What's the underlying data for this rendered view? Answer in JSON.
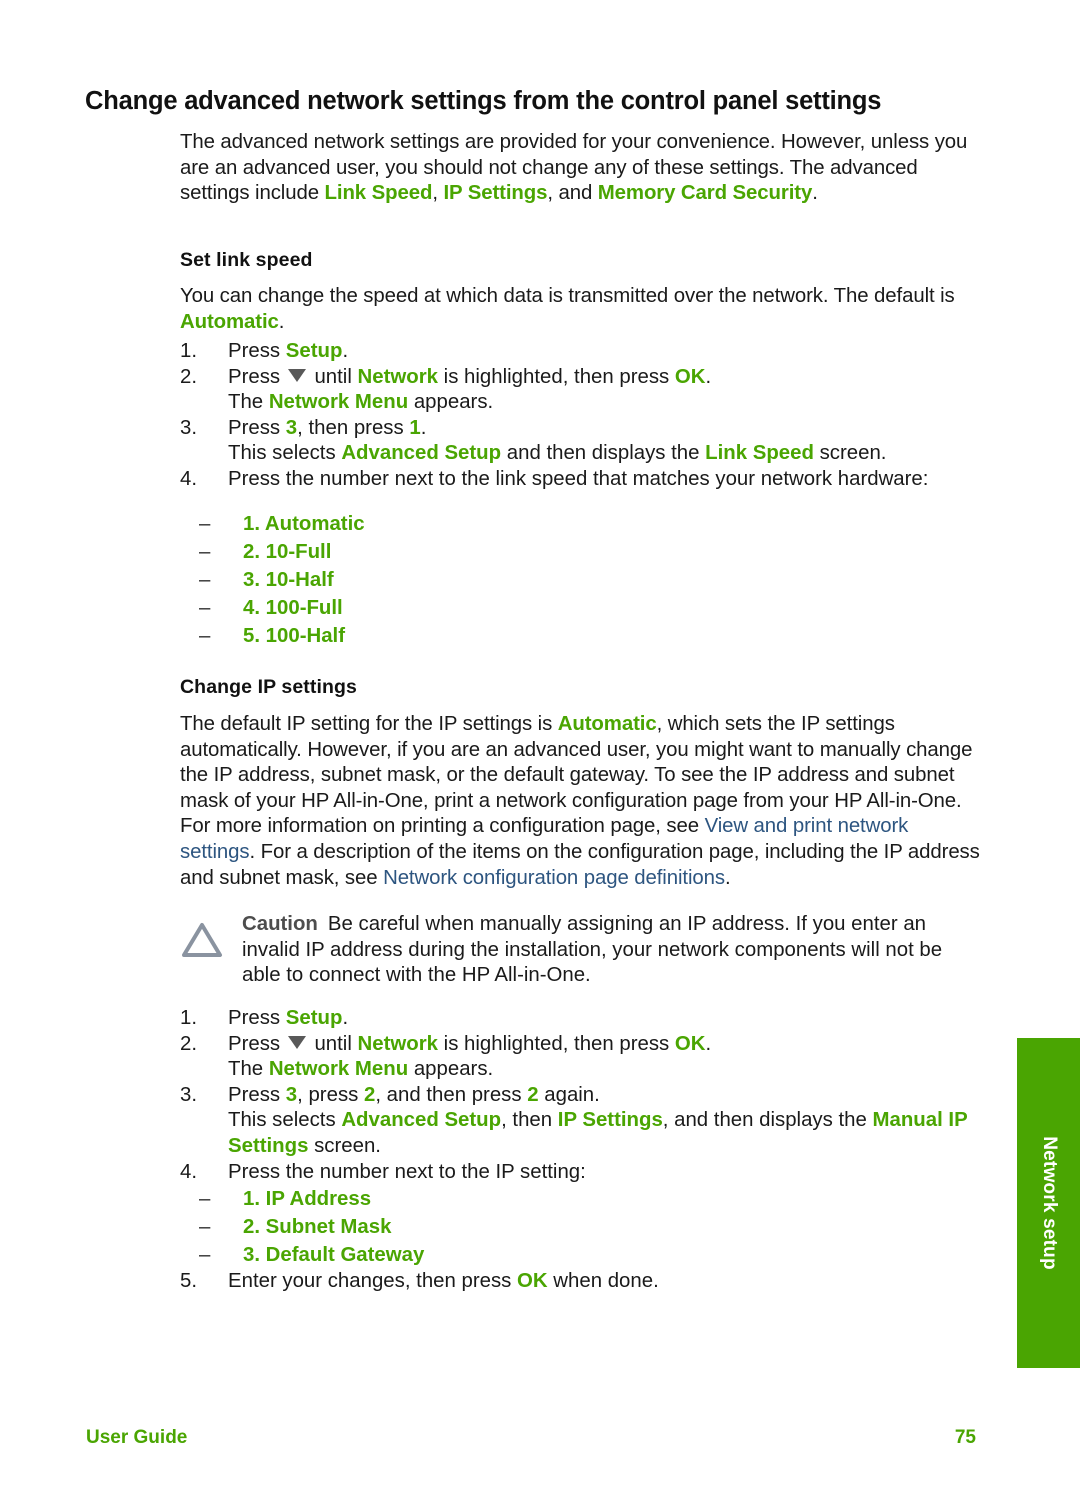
{
  "colors": {
    "accent_green": "#4aa502",
    "link_blue": "#2d5580",
    "caution_gray": "#8a93a0",
    "text": "#1a1a1a"
  },
  "heading": {
    "title": "Change advanced network settings from the control panel settings"
  },
  "intro": {
    "line_a": "The advanced network settings are provided for your convenience. However, unless you are an advanced user, you should not change any of these settings. The advanced settings include ",
    "term_1": "Link Speed",
    "sep_1": ", ",
    "term_2": "IP Settings",
    "sep_2": ", and ",
    "term_3": "Memory Card Security",
    "end": "."
  },
  "link_speed": {
    "heading": "Set link speed",
    "intro_a": "You can change the speed at which data is transmitted over the network. The default is ",
    "intro_term": "Automatic",
    "intro_b": ".",
    "steps": [
      {
        "pre": "Press ",
        "term": "Setup",
        "post": "."
      },
      {
        "pre": "Press ",
        "arrow": "down-triangle",
        "mid": " until ",
        "term": "Network",
        "mid2": " is highlighted, then press ",
        "term2": "OK",
        "post": "."
      },
      {
        "cont_pre": "The ",
        "cont_term": "Network Menu",
        "cont_post": " appears."
      },
      {
        "pre": "Press ",
        "term": "3",
        "mid": ", then press ",
        "term2": "1",
        "post": "."
      },
      {
        "cont_pre": "This selects ",
        "cont_term": "Advanced Setup",
        "cont_mid": " and then displays the ",
        "cont_term2": "Link Speed",
        "cont_post": " screen."
      },
      {
        "pre": "Press the number next to the link speed that matches your network hardware:"
      }
    ],
    "options": [
      "1. Automatic",
      "2. 10-Full",
      "3. 10-Half",
      "4. 100-Full",
      "5. 100-Half"
    ]
  },
  "ip_settings": {
    "heading": "Change IP settings",
    "para_a": "The default IP setting for the IP settings is ",
    "para_term": "Automatic",
    "para_b": ", which sets the IP settings automatically. However, if you are an advanced user, you might want to manually change the IP address, subnet mask, or the default gateway. To see the IP address and subnet mask of your HP All-in-One, print a network configuration page from your HP All-in-One. For more information on printing a configuration page, see ",
    "link_1": "View and print network settings",
    "para_c": ". For a description of the items on the configuration page, including the IP address and subnet mask, see ",
    "link_2": "Network configuration page definitions",
    "para_d": ".",
    "caution": {
      "icon": "warning-triangle-icon",
      "label": "Caution",
      "text": "Be careful when manually assigning an IP address. If you enter an invalid IP address during the installation, your network components will not be able to connect with the HP All-in-One."
    },
    "steps": [
      {
        "pre": "Press ",
        "term": "Setup",
        "post": "."
      },
      {
        "pre": "Press ",
        "arrow": "down-triangle",
        "mid": " until ",
        "term": "Network",
        "mid2": " is highlighted, then press ",
        "term2": "OK",
        "post": "."
      },
      {
        "cont_pre": "The ",
        "cont_term": "Network Menu",
        "cont_post": " appears."
      },
      {
        "pre": "Press ",
        "term": "3",
        "mid": ", press ",
        "term2": "2",
        "mid3": ", and then press ",
        "term3": "2",
        "post": " again."
      },
      {
        "cont_pre": "This selects ",
        "cont_term": "Advanced Setup",
        "cont_mid": ", then ",
        "cont_term2": "IP Settings",
        "cont_mid2": ", and then displays the ",
        "cont_term3": "Manual IP Settings",
        "cont_post": " screen."
      },
      {
        "pre": "Press the number next to the IP setting:"
      },
      {
        "pre": "Enter your changes, then press ",
        "term": "OK",
        "post": " when done."
      }
    ],
    "options": [
      "1. IP Address",
      "2. Subnet Mask",
      "3. Default Gateway"
    ]
  },
  "side_tab": {
    "label": "Network setup"
  },
  "footer": {
    "left": "User Guide",
    "page_number": "75"
  }
}
